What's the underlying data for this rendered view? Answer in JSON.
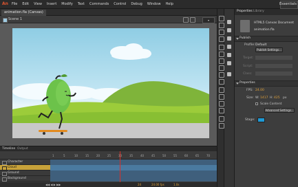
{
  "app": {
    "logo": "An"
  },
  "menu": [
    "File",
    "Edit",
    "View",
    "Insert",
    "Modify",
    "Text",
    "Commands",
    "Control",
    "Debug",
    "Window",
    "Help"
  ],
  "workspace": "Essentials",
  "document": {
    "tab": "animation.fla (Canvas)",
    "scene": "Scene 1"
  },
  "timeline": {
    "tabs": {
      "timeline": "Timeline",
      "output": "Output"
    },
    "ruler": [
      "1",
      "5",
      "10",
      "15",
      "20",
      "25",
      "30",
      "35",
      "40",
      "45",
      "50",
      "55",
      "60",
      "65",
      "70"
    ],
    "layers": [
      {
        "name": "Character"
      },
      {
        "name": "Cloud",
        "selected": true
      },
      {
        "name": "Ground"
      },
      {
        "name": "Background"
      }
    ],
    "footer": {
      "frame": "24",
      "fps": "24.00 fps",
      "time": "1.0s"
    }
  },
  "properties": {
    "tabs": {
      "properties": "Properties",
      "library": "Library"
    },
    "doc_type": "HTML5 Canvas Document",
    "doc_name": "animation.fla",
    "publish": {
      "header": "Publish",
      "profile_label": "Profile:",
      "profile_value": "Default",
      "settings_button": "Publish Settings...",
      "target_label": "Target:",
      "script_label": "Script:",
      "class_label": "Class:"
    },
    "props": {
      "header": "Properties",
      "fps_label": "FPS:",
      "fps_value": "24.00",
      "size_label": "Size:",
      "w_label": "W:",
      "w_value": "1417",
      "h_label": "H:",
      "h_value": "425",
      "px": "px",
      "scale_label": "Scale Content",
      "advanced_button": "Advanced Settings...",
      "stage_label": "Stage:",
      "stage_color": "#1e9ad6"
    }
  },
  "colors": {
    "accent": "#e2a33b",
    "selected_layer": "#c8a23a",
    "playhead": "#d8312b"
  }
}
